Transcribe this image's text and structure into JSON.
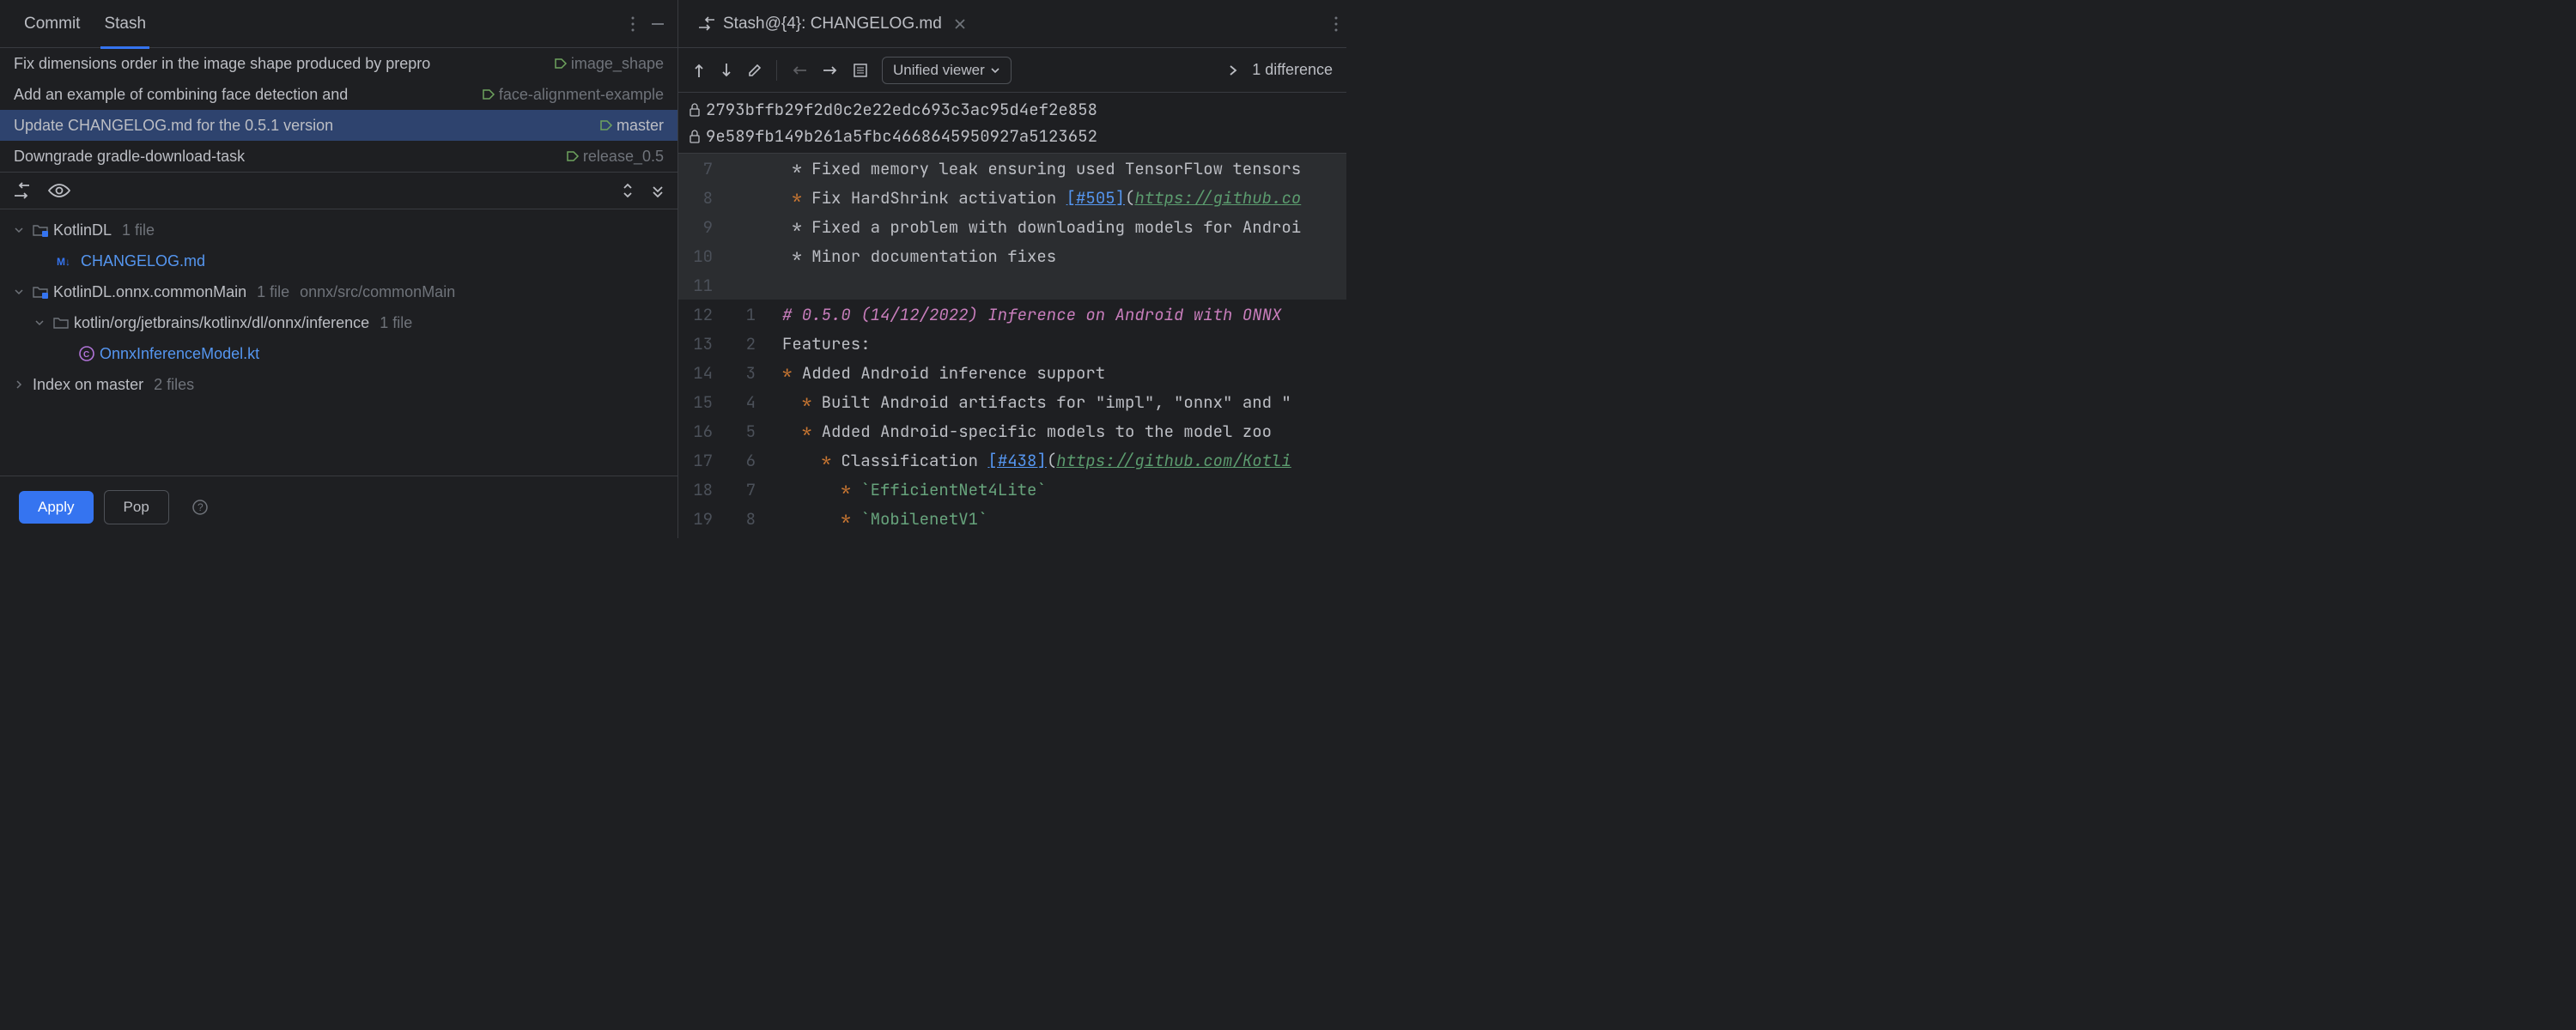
{
  "tabs": {
    "commit": "Commit",
    "stash": "Stash"
  },
  "commits": [
    {
      "msg": "Fix dimensions order in the image shape produced by prepro",
      "tag": "image_shape"
    },
    {
      "msg": "Add an example of combining face detection and",
      "tag": "face-alignment-example"
    },
    {
      "msg": "Update CHANGELOG.md for the 0.5.1 version",
      "tag": "master"
    },
    {
      "msg": "Downgrade gradle-download-task",
      "tag": "release_0.5"
    }
  ],
  "tree": {
    "root_a": "KotlinDL",
    "root_a_meta": "1 file",
    "file_a": "CHANGELOG.md",
    "root_b": "KotlinDL.onnx.commonMain",
    "root_b_meta": "1 file",
    "root_b_path": "onnx/src/commonMain",
    "dir_b": "kotlin/org/jetbrains/kotlinx/dl/onnx/inference",
    "dir_b_meta": "1 file",
    "file_b": "OnnxInferenceModel.kt",
    "root_c": "Index on master",
    "root_c_meta": "2 files"
  },
  "buttons": {
    "apply": "Apply",
    "pop": "Pop"
  },
  "editor_tab": "Stash@{4}: CHANGELOG.md",
  "viewer_label": "Unified viewer",
  "diff_count": "1 difference",
  "hashes": {
    "a": "2793bffb29f2d0c2e22edc693c3ac95d4ef2e858",
    "b": "9e589fb149b261a5fbc4668645950927a5123652"
  },
  "lines": [
    {
      "l": "7",
      "r": "",
      "t": " * Fixed memory leak ensuring used TensorFlow tensors",
      "bg": "dark"
    },
    {
      "l": "8",
      "r": "",
      "t": " * Fix HardShrink activation [#505](https://github.co",
      "bg": "dark",
      "link": true
    },
    {
      "l": "9",
      "r": "",
      "t": " * Fixed a problem with downloading models for Androi",
      "bg": "dark"
    },
    {
      "l": "10",
      "r": "",
      "t": " * Minor documentation fixes",
      "bg": "dark"
    },
    {
      "l": "11",
      "r": "",
      "t": "",
      "bg": "dark"
    },
    {
      "l": "12",
      "r": "1",
      "t": "# 0.5.0 (14/12/2022) Inference on Android with ONNX",
      "heading": true
    },
    {
      "l": "13",
      "r": "2",
      "t": "Features:"
    },
    {
      "l": "14",
      "r": "3",
      "t": "* Added Android inference support",
      "bullet": true
    },
    {
      "l": "15",
      "r": "4",
      "t": "  * Built Android artifacts for \"impl\", \"onnx\" and \"",
      "bullet": true
    },
    {
      "l": "16",
      "r": "5",
      "t": "  * Added Android-specific models to the model zoo",
      "bullet": true
    },
    {
      "l": "17",
      "r": "6",
      "t": "    * Classification [#438](https://github.com/Kotli",
      "bullet": true,
      "link": true
    },
    {
      "l": "18",
      "r": "7",
      "t": "      * `EfficientNet4Lite`",
      "bullet": true,
      "code": true
    },
    {
      "l": "19",
      "r": "8",
      "t": "      * `MobilenetV1`",
      "bullet": true,
      "code": true
    }
  ]
}
